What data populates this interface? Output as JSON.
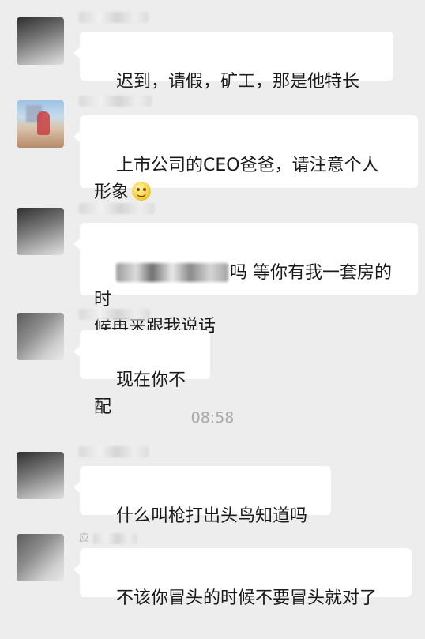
{
  "timestamp": "08:58",
  "messages": [
    {
      "nick": "",
      "text": "迟到，请假，矿工，那是他特长"
    },
    {
      "nick": "",
      "text": "上市公司的CEO爸爸，请注意个人",
      "text2": "形象",
      "emoji": "smiling-face-emoji"
    },
    {
      "nick": "",
      "text_suffix": "吗 等你有我一套房的时",
      "text2": "候再来跟我说话"
    },
    {
      "nick": "",
      "text": "现在你不配"
    },
    {
      "nick": "",
      "text": "什么叫枪打出头鸟知道吗"
    },
    {
      "nick": "应",
      "text": "不该你冒头的时候不要冒头就对了"
    }
  ]
}
